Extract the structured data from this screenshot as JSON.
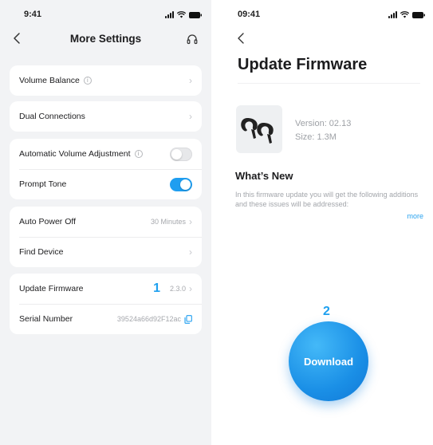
{
  "colors": {
    "accent": "#1f9ef0",
    "left_background": "#f2f3f5",
    "card_background": "#ffffff",
    "muted_text": "#a6a8ad"
  },
  "left_screen": {
    "status_time": "9:41",
    "title": "More Settings",
    "back_icon": "chevron-left-icon",
    "support_icon": "headset-icon",
    "groups": [
      {
        "rows": [
          {
            "label": "Volume Balance",
            "info_icon": true,
            "value": "",
            "control": "chevron"
          }
        ]
      },
      {
        "rows": [
          {
            "label": "Dual Connections",
            "value": "",
            "control": "chevron"
          }
        ]
      },
      {
        "rows": [
          {
            "label": "Automatic Volume Adjustment",
            "info_icon": true,
            "control": "toggle",
            "on": false
          },
          {
            "label": "Prompt Tone",
            "control": "toggle",
            "on": true
          }
        ]
      },
      {
        "rows": [
          {
            "label": "Auto Power Off",
            "value": "30 Minutes",
            "control": "chevron"
          },
          {
            "label": "Find Device",
            "value": "",
            "control": "chevron"
          }
        ]
      },
      {
        "rows": [
          {
            "label": "Update Firmware",
            "marker": "1",
            "value": "2.3.0",
            "control": "chevron"
          },
          {
            "label": "Serial Number",
            "value": "39524a66d92F12ac",
            "control": "copy"
          }
        ]
      }
    ]
  },
  "right_screen": {
    "status_time": "09:41",
    "title": "Update Firmware",
    "version": "Version: 02.13",
    "size": "Size: 1.3M",
    "whats_new_heading": "What’s New",
    "description": "In this firmware update you will get the following additions and these issues will be addressed:",
    "more_link": "more",
    "marker": "2",
    "download_label": "Download"
  }
}
